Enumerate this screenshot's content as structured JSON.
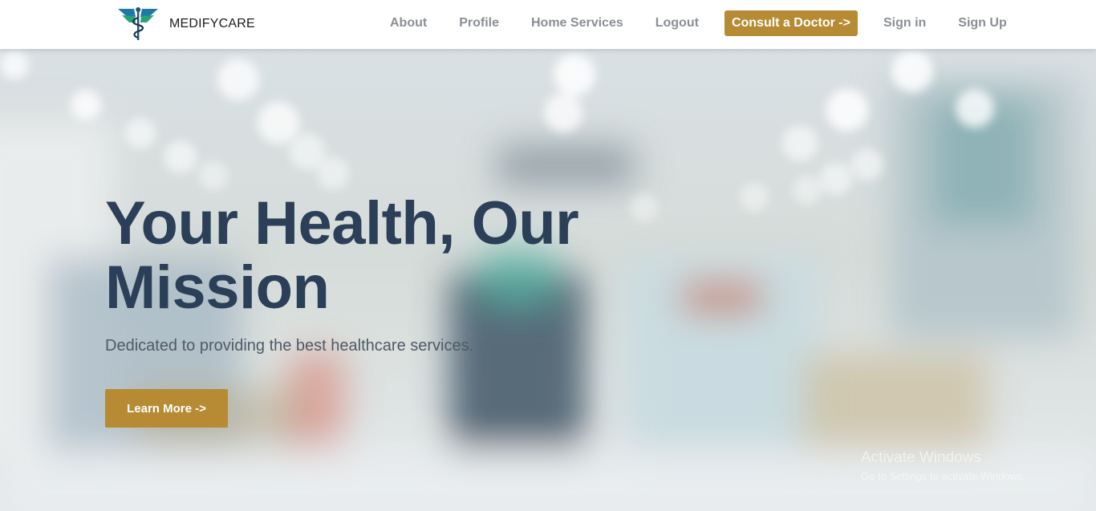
{
  "brand": {
    "name": "MEDIFYCARE",
    "logo_icon": "caduceus-wings-logo"
  },
  "nav": {
    "links": [
      "About",
      "Profile",
      "Home Services",
      "Logout"
    ],
    "consult_label": "Consult a Doctor ->",
    "signin_label": "Sign in",
    "signup_label": "Sign Up"
  },
  "hero": {
    "title_line1": "Your Health, Our",
    "title_line2": "Mission",
    "subtitle": "Dedicated to providing the best healthcare services.",
    "cta_label": "Learn More ->"
  },
  "watermark": {
    "title": "Activate Windows",
    "subtitle": "Go to Settings to activate Windows."
  },
  "colors": {
    "accent": "#b68b33",
    "heading": "#2b3f58",
    "nav_text": "#8a8f96"
  }
}
